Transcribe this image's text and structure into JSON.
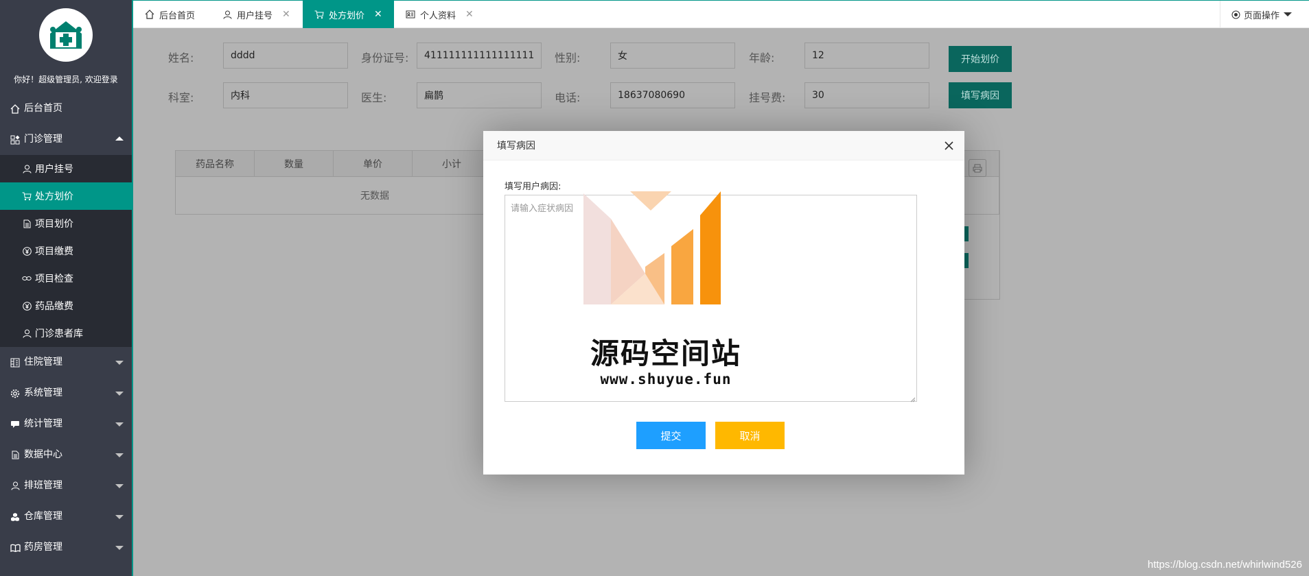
{
  "sidebar": {
    "welcome": "你好！超级管理员, 欢迎登录",
    "home": "后台首页",
    "outpatient": "门诊管理",
    "outpatient_items": [
      "用户挂号",
      "处方划价",
      "项目划价",
      "项目缴费",
      "项目检查",
      "药品缴费",
      "门诊患者库"
    ],
    "groups": [
      "住院管理",
      "系统管理",
      "统计管理",
      "数据中心",
      "排班管理",
      "仓库管理",
      "药房管理"
    ]
  },
  "tabs": [
    {
      "label": "后台首页",
      "icon": "home-icon"
    },
    {
      "label": "用户挂号",
      "icon": "user-icon"
    },
    {
      "label": "处方划价",
      "icon": "cart-icon"
    },
    {
      "label": "个人资料",
      "icon": "id-card-icon"
    }
  ],
  "page_ops": "页面操作",
  "form": {
    "name_label": "姓名:",
    "name": "dddd",
    "id_label": "身份证号:",
    "id": "411111111111111111",
    "gender_label": "性别:",
    "gender": "女",
    "age_label": "年龄:",
    "age": "12",
    "dept_label": "科室:",
    "dept": "内科",
    "doctor_label": "医生:",
    "doctor": "扁鹊",
    "phone_label": "电话:",
    "phone": "18637080690",
    "fee_label": "挂号费:",
    "fee": "30",
    "start_btn": "开始划价",
    "cause_btn": "填写病因"
  },
  "table": {
    "headers": [
      "药品名称",
      "数量",
      "单价",
      "小计"
    ],
    "empty": "无数据"
  },
  "modal": {
    "title": "填写病因",
    "label": "填写用户病因:",
    "placeholder": "请输入症状病因",
    "submit": "提交",
    "cancel": "取消"
  },
  "watermark": {
    "title": "源码空间站",
    "url": "www.shuyue.fun"
  },
  "credit": "https://blog.csdn.net/whirlwind526",
  "colors": {
    "primary": "#009688",
    "sidebar": "#393d49",
    "submit": "#1e9fff",
    "cancel": "#ffb800"
  }
}
